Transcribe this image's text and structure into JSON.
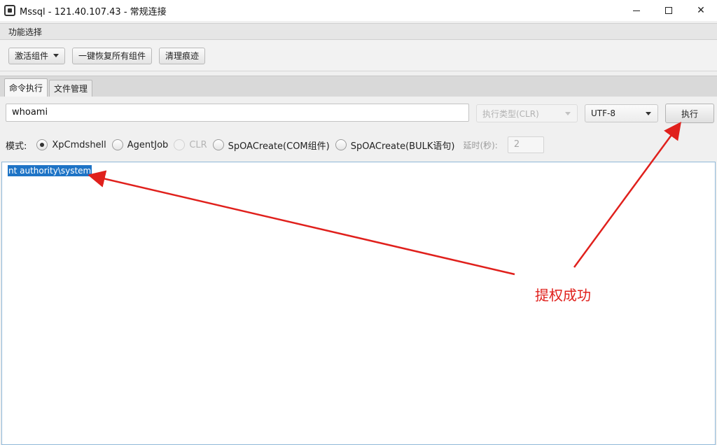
{
  "window": {
    "title": "Mssql - 121.40.107.43 - 常规连接",
    "icon": "app-icon"
  },
  "menubar": {
    "label": "功能选择"
  },
  "toolbar": {
    "activate_label": "激活组件",
    "restore_label": "一键恢复所有组件",
    "clean_label": "清理痕迹"
  },
  "tabs": [
    {
      "label": "命令执行",
      "active": true
    },
    {
      "label": "文件管理",
      "active": false
    }
  ],
  "command": {
    "value": "whoami",
    "exec_type_label": "执行类型(CLR)",
    "encoding": "UTF-8",
    "exec_button": "执行"
  },
  "mode": {
    "label": "模式:",
    "options": [
      {
        "label": "XpCmdshell",
        "checked": true,
        "enabled": true
      },
      {
        "label": "AgentJob",
        "checked": false,
        "enabled": true
      },
      {
        "label": "CLR",
        "checked": false,
        "enabled": false
      },
      {
        "label": "SpOACreate(COM组件)",
        "checked": false,
        "enabled": true
      },
      {
        "label": "SpOACreate(BULK语句)",
        "checked": false,
        "enabled": true
      }
    ],
    "delay_label": "延时(秒):",
    "delay_value": "2"
  },
  "output": {
    "text": "nt authority\\system"
  },
  "annotation": {
    "text": "提权成功",
    "color": "#e0201c"
  }
}
